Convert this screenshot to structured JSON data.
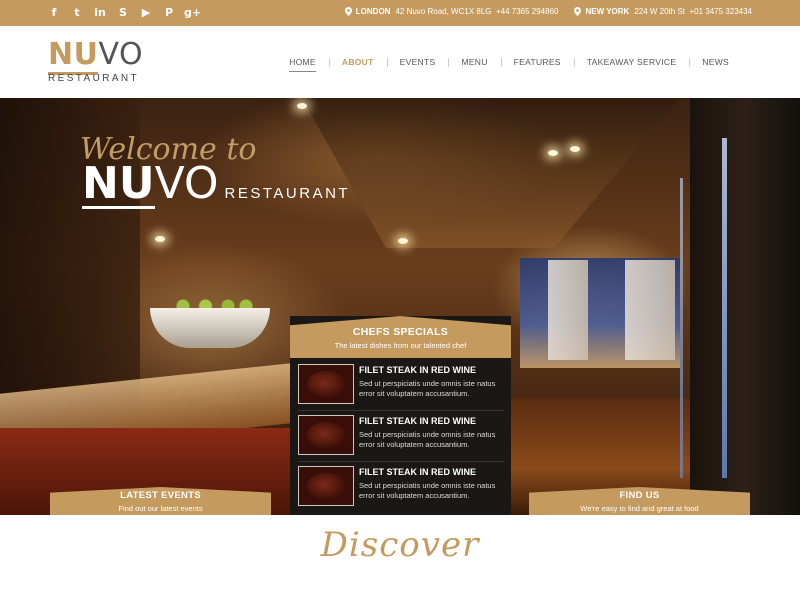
{
  "topbar": {
    "social": [
      {
        "name": "facebook-icon",
        "glyph": "f"
      },
      {
        "name": "twitter-icon",
        "glyph": "t"
      },
      {
        "name": "linkedin-icon",
        "glyph": "in"
      },
      {
        "name": "skype-icon",
        "glyph": "S"
      },
      {
        "name": "youtube-icon",
        "glyph": "▶"
      },
      {
        "name": "pinterest-icon",
        "glyph": "P"
      },
      {
        "name": "google-plus-icon",
        "glyph": "g+"
      }
    ],
    "london_label": "LONDON",
    "london_address": "42 Nuvo Road, WC1X 8LG",
    "london_phone": "+44 7365 294860",
    "newyork_label": "NEW YORK",
    "newyork_address": "224 W 20th St",
    "newyork_phone": "+01 3475 323434"
  },
  "logo": {
    "nu": "NU",
    "vo": "VO",
    "sub": "RESTAURANT"
  },
  "nav": [
    "HOME",
    "ABOUT",
    "EVENTS",
    "MENU",
    "FEATURES",
    "TAKEAWAY SERVICE",
    "NEWS"
  ],
  "hero": {
    "welcome": "Welcome to",
    "nu": "NU",
    "vo": "VO",
    "restaurant": "RESTAURANT"
  },
  "chefs": {
    "title": "CHEFS SPECIALS",
    "subtitle": "The latest dishes from our talented chef",
    "dishes": [
      {
        "name": "FILET STEAK IN RED WINE",
        "desc": "Sed ut perspiciatis unde omnis iste natus error sit voluptatem accusantium."
      },
      {
        "name": "FILET STEAK IN RED WINE",
        "desc": "Sed ut perspiciatis unde omnis iste natus error sit voluptatem accusantium."
      },
      {
        "name": "FILET STEAK IN RED WINE",
        "desc": "Sed ut perspiciatis unde omnis iste natus error sit voluptatem accusantium."
      }
    ]
  },
  "events_tab": {
    "title": "LATEST EVENTS",
    "subtitle": "Find out our latest events"
  },
  "findus_tab": {
    "title": "FIND US",
    "subtitle": "We're easy to find and great at food"
  },
  "discover": "Discover",
  "colors": {
    "accent": "#c49a5e",
    "panel": "#1a1714"
  }
}
